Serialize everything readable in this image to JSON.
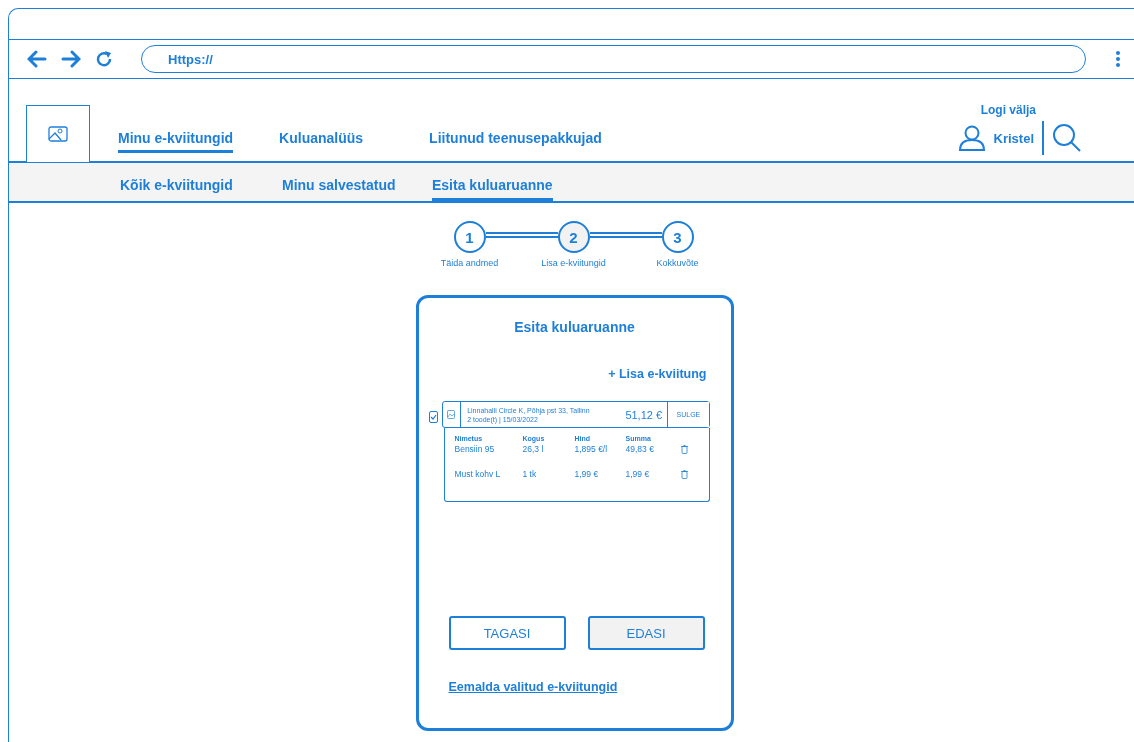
{
  "browser": {
    "address": "Https://"
  },
  "header": {
    "logout": "Logi välja",
    "user": "Kristel"
  },
  "nav": [
    {
      "label": "Minu e-kviitungid",
      "selected": true
    },
    {
      "label": "Kuluanalüüs",
      "selected": false
    },
    {
      "label": "Liitunud teenusepakkujad",
      "selected": false
    }
  ],
  "subnav": [
    {
      "label": "Kõik e-kviitungid",
      "selected": false
    },
    {
      "label": "Minu salvestatud",
      "selected": false
    },
    {
      "label": "Esita kuluaruanne",
      "selected": true
    }
  ],
  "steps": [
    {
      "number": "1",
      "label": "Täida andmed",
      "selected": false
    },
    {
      "number": "2",
      "label": "Lisa e-kviitungid",
      "selected": true
    },
    {
      "number": "3",
      "label": "Kokkuvõte",
      "selected": false
    }
  ],
  "card": {
    "title": "Esita kuluaruanne",
    "add_link": "+ Lisa e-kviitung",
    "receipts": [
      {
        "checked": true,
        "merchant": "Linnahalli Circle K, Põhja pst 33, Tallinn",
        "details": "2 toode(t) | 15/03/2022",
        "total": "51,12 €",
        "toggle": "SULGE",
        "expanded": true,
        "columns": [
          "Nimetus",
          "Kogus",
          "Hind",
          "Summa"
        ],
        "items": [
          [
            "Bensiin 95",
            "26,3 l",
            "1,895 €/l",
            "49,83 €"
          ],
          [
            "Must kohv L",
            "1 tk",
            "1,99 €",
            "1,99 €"
          ]
        ]
      }
    ],
    "buttons": [
      {
        "label": "TAGASI",
        "kind": "secondary"
      },
      {
        "label": "EDASI",
        "kind": "primary"
      }
    ],
    "remove_link": "Eemalda valitud e-kviitungid"
  }
}
